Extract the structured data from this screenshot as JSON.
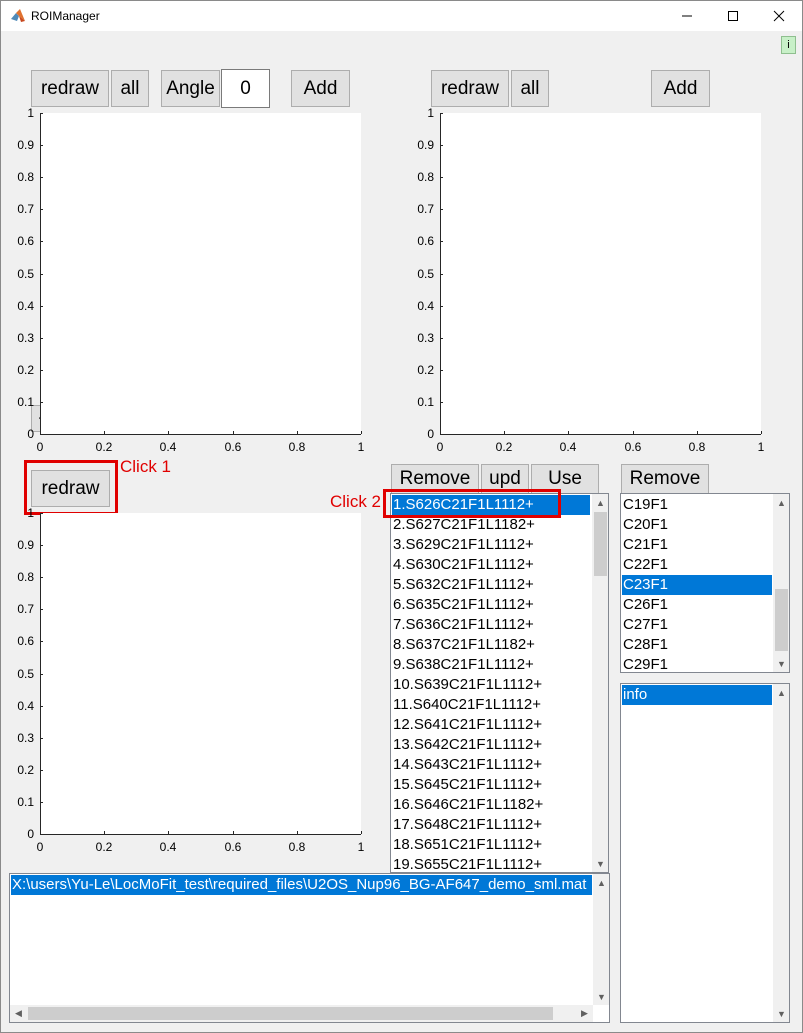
{
  "window": {
    "title": "ROIManager"
  },
  "info_button": "i",
  "top_left": {
    "redraw": "redraw",
    "all": "all",
    "angle_label": "Angle",
    "angle_value": "0",
    "add": "Add",
    "back": "<-"
  },
  "top_right": {
    "redraw": "redraw",
    "all": "all",
    "add": "Add"
  },
  "bottom_left": {
    "redraw": "redraw"
  },
  "axis_ticks": {
    "y": [
      "0",
      "0.1",
      "0.2",
      "0.3",
      "0.4",
      "0.5",
      "0.6",
      "0.7",
      "0.8",
      "0.9",
      "1"
    ],
    "x": [
      "0",
      "0.2",
      "0.4",
      "0.6",
      "0.8",
      "1"
    ]
  },
  "site_panel": {
    "remove": "Remove",
    "upd": "upd",
    "use": "Use",
    "items": [
      "1.S626C21F1L1112+",
      "2.S627C21F1L1182+",
      "3.S629C21F1L1112+",
      "4.S630C21F1L1112+",
      "5.S632C21F1L1112+",
      "6.S635C21F1L1112+",
      "7.S636C21F1L1112+",
      "8.S637C21F1L1182+",
      "9.S638C21F1L1112+",
      "10.S639C21F1L1112+",
      "11.S640C21F1L1112+",
      "12.S641C21F1L1112+",
      "13.S642C21F1L1112+",
      "14.S643C21F1L1112+",
      "15.S645C21F1L1112+",
      "16.S646C21F1L1182+",
      "17.S648C21F1L1112+",
      "18.S651C21F1L1112+",
      "19.S655C21F1L1112+"
    ],
    "selected_index": 0
  },
  "cell_panel": {
    "remove": "Remove",
    "items": [
      "C19F1",
      "C20F1",
      "C21F1",
      "C22F1",
      "C23F1",
      "C26F1",
      "C27F1",
      "C28F1",
      "C29F1"
    ],
    "selected_index": 4
  },
  "info_panel": {
    "items": [
      "info"
    ],
    "selected_index": 0
  },
  "file_panel": {
    "items": [
      "X:\\users\\Yu-Le\\LocMoFit_test\\required_files\\U2OS_Nup96_BG-AF647_demo_sml.mat"
    ],
    "selected_index": 0
  },
  "annotations": {
    "click1": "Click 1",
    "click2": "Click 2",
    "color": "#e00000"
  },
  "colors": {
    "selection": "#0078d7",
    "panel_bg": "#f0f0f0",
    "button_bg": "#e1e1e1"
  }
}
